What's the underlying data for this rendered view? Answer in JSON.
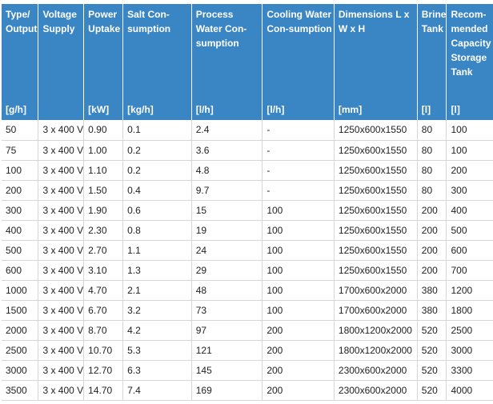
{
  "columns": [
    {
      "name": "Type/ Output",
      "unit": "[g/h]"
    },
    {
      "name": "Voltage Supply",
      "unit": ""
    },
    {
      "name": "Power Uptake",
      "unit": "[kW]"
    },
    {
      "name": "Salt Con-sumption",
      "unit": "[kg/h]"
    },
    {
      "name": "Process Water Con-sumption",
      "unit": "[l/h]"
    },
    {
      "name": "Cooling Water Con-sumption",
      "unit": "[l/h]"
    },
    {
      "name": "Dimensions L x W x H",
      "unit": "[mm]"
    },
    {
      "name": "Brine Tank",
      "unit": "[l]"
    },
    {
      "name": "Recom-mended Capacity Storage Tank",
      "unit": "[l]"
    }
  ],
  "rows": [
    [
      "50",
      "3 x 400 V",
      "0.90",
      "0.1",
      "2.4",
      "-",
      "1250x600x1550",
      "80",
      "100"
    ],
    [
      "75",
      "3 x 400 V",
      "1.00",
      "0.2",
      "3.6",
      "-",
      "1250x600x1550",
      "80",
      "100"
    ],
    [
      "100",
      "3 x 400 V",
      "1.10",
      "0.2",
      "4.8",
      "-",
      "1250x600x1550",
      "80",
      "200"
    ],
    [
      "200",
      "3 x 400 V",
      "1.50",
      "0.4",
      "9.7",
      "-",
      "1250x600x1550",
      "80",
      "300"
    ],
    [
      "300",
      "3 x 400 V",
      "1.90",
      "0.6",
      "15",
      "100",
      "1250x600x1550",
      "200",
      "400"
    ],
    [
      "400",
      "3 x 400 V",
      "2.30",
      "0.8",
      "19",
      "100",
      "1250x600x1550",
      "200",
      "500"
    ],
    [
      "500",
      "3 x 400 V",
      "2.70",
      "1.1",
      "24",
      "100",
      "1250x600x1550",
      "200",
      "600"
    ],
    [
      "600",
      "3 x 400 V",
      "3.10",
      "1.3",
      "29",
      "100",
      "1250x600x1550",
      "200",
      "700"
    ],
    [
      "1000",
      "3 x 400 V",
      "4.70",
      "2.1",
      "48",
      "100",
      "1700x600x2000",
      "380",
      "1200"
    ],
    [
      "1500",
      "3 x 400 V",
      "6.70",
      "3.2",
      "73",
      "100",
      "1700x600x2000",
      "380",
      "1800"
    ],
    [
      "2000",
      "3 x 400 V",
      "8.70",
      "4.2",
      "97",
      "200",
      "1800x1200x2000",
      "520",
      "2500"
    ],
    [
      "2500",
      "3 x 400 V",
      "10.70",
      "5.3",
      "121",
      "200",
      "1800x1200x2000",
      "520",
      "3000"
    ],
    [
      "3000",
      "3 x 400 V",
      "12.70",
      "6.3",
      "145",
      "200",
      "2300x600x2000",
      "520",
      "3300"
    ],
    [
      "3500",
      "3 x 400 V",
      "14.70",
      "7.4",
      "169",
      "200",
      "2300x600x2000",
      "520",
      "4000"
    ]
  ]
}
